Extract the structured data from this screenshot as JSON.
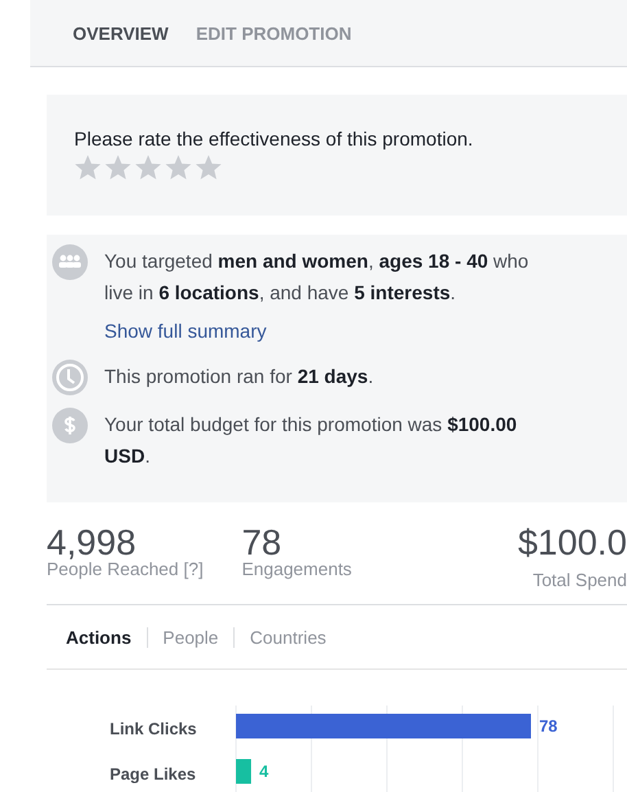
{
  "tabs": [
    {
      "label": "OVERVIEW",
      "selected": true
    },
    {
      "label": "EDIT PROMOTION",
      "selected": false
    }
  ],
  "rating": {
    "prompt": "Please rate the effectiveness of this promotion.",
    "stars": 0
  },
  "summary": [
    {
      "kind": "people",
      "text": "You targeted **men and women**, **ages 18 - 40** who live in **6 locations**, and have **5 interests**.",
      "link": "Show full summary"
    },
    {
      "kind": "clock",
      "text": "This promotion ran for **21 days**."
    },
    {
      "kind": "dollar",
      "text": "Your total budget for this promotion was **$100.00 USD**."
    }
  ],
  "stats": [
    {
      "value": "4,998",
      "label": "People Reached [?]"
    },
    {
      "value": "78",
      "label": "Engagements"
    },
    {
      "value": "$100.0",
      "label": "Total Spend"
    }
  ],
  "subtabs": [
    {
      "label": "Actions",
      "selected": true
    },
    {
      "label": "People",
      "selected": false
    },
    {
      "label": "Countries",
      "selected": false
    }
  ],
  "chart_data": {
    "type": "bar",
    "orientation": "horizontal",
    "categories": [
      "Link Clicks",
      "Page Likes"
    ],
    "data_labels": true,
    "series": [
      {
        "color": "#3b63d4",
        "values": [
          78,
          null
        ]
      },
      {
        "color": "#17bfa1",
        "values": [
          null,
          4
        ]
      }
    ]
  }
}
